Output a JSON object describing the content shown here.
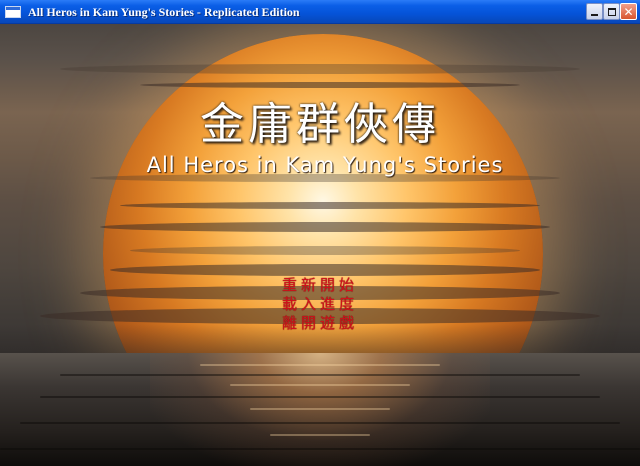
{
  "window": {
    "title": "All Heros in Kam Yung's Stories - Replicated Edition",
    "controls": {
      "minimize_icon": "minimize-icon",
      "maximize_icon": "maximize-icon",
      "close_icon": "close-icon",
      "close_glyph": "✕"
    }
  },
  "game": {
    "title_cn": "金庸群俠傳",
    "title_en": "All Heros in Kam Yung's Stories",
    "menu": [
      {
        "label": "重新開始"
      },
      {
        "label": "載入進度"
      },
      {
        "label": "離開遊戲"
      }
    ],
    "menu_color": "#d1111b"
  }
}
